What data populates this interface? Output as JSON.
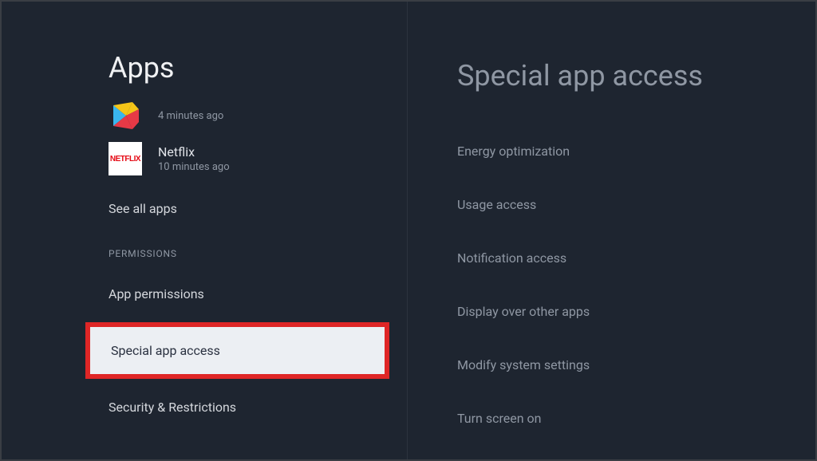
{
  "left": {
    "title": "Apps",
    "recentApps": [
      {
        "name": "",
        "time": "4 minutes ago",
        "iconType": "play"
      },
      {
        "name": "Netflix",
        "time": "10 minutes ago",
        "iconType": "netflix"
      }
    ],
    "seeAll": "See all apps",
    "sectionHeader": "PERMISSIONS",
    "items": {
      "appPermissions": "App permissions",
      "specialAppAccess": "Special app access",
      "securityRestrictions": "Security & Restrictions"
    }
  },
  "right": {
    "title": "Special app access",
    "items": {
      "energy": "Energy optimization",
      "usage": "Usage access",
      "notification": "Notification access",
      "display": "Display over other apps",
      "modify": "Modify system settings",
      "turnScreen": "Turn screen on"
    }
  }
}
